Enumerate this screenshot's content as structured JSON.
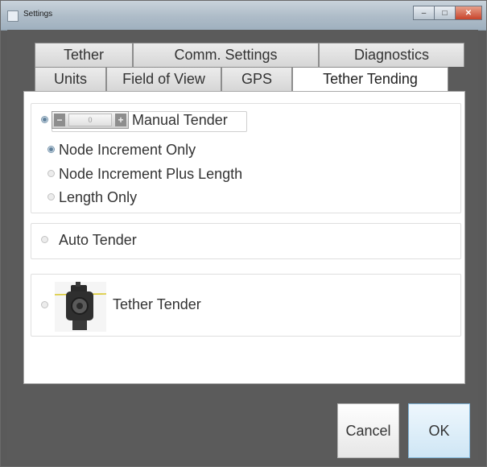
{
  "window": {
    "title": "Settings"
  },
  "titlebar_controls": {
    "minimize": "–",
    "maximize": "□",
    "close": "✕"
  },
  "tabs_row1": [
    "Tether",
    "Comm. Settings",
    "Diagnostics"
  ],
  "tabs_row2": [
    "Units",
    "Field of View",
    "GPS",
    "Tether Tending"
  ],
  "active_tab": "Tether Tending",
  "manual": {
    "label": "Manual Tender",
    "stepper": {
      "minus": "−",
      "value": "0",
      "plus": "+"
    },
    "options": [
      "Node Increment Only",
      "Node Increment Plus Length",
      "Length Only"
    ],
    "selected_option": "Node Increment Only"
  },
  "auto": {
    "label": "Auto Tender"
  },
  "tether_tender": {
    "label": "Tether Tender",
    "icon": "tether-tender-device-icon"
  },
  "buttons": {
    "cancel": "Cancel",
    "ok": "OK"
  },
  "colors": {
    "ok_accent": "#7fb3d6",
    "window_bg": "#5b5b5b"
  }
}
